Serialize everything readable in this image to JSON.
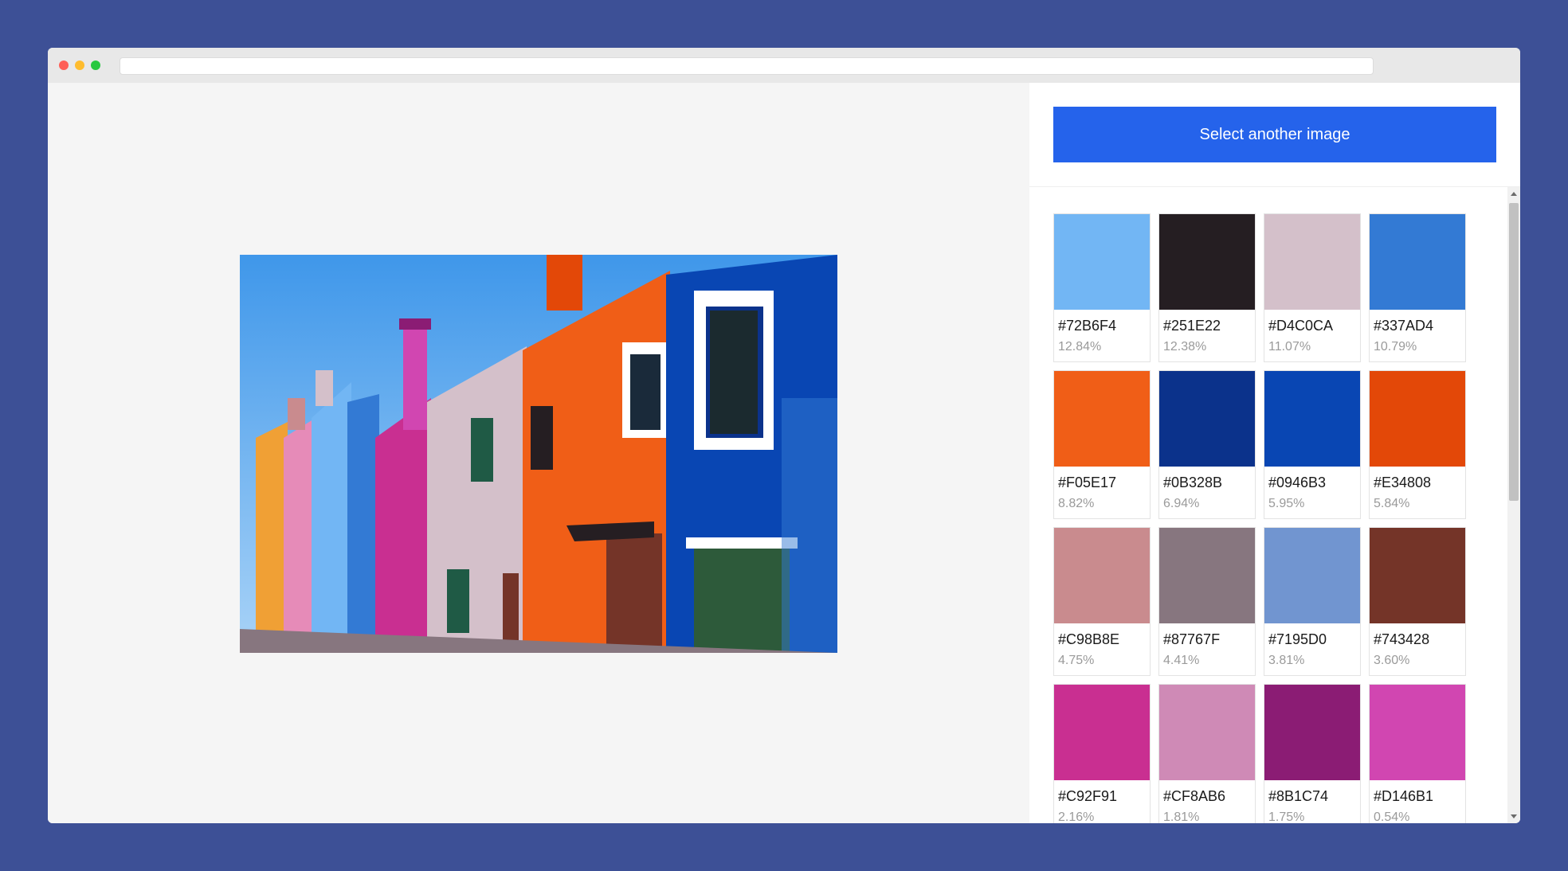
{
  "browser": {
    "url": ""
  },
  "sidebar": {
    "select_button_label": "Select another image"
  },
  "palette": [
    {
      "hex": "#72B6F4",
      "percent": "12.84%"
    },
    {
      "hex": "#251E22",
      "percent": "12.38%"
    },
    {
      "hex": "#D4C0CA",
      "percent": "11.07%"
    },
    {
      "hex": "#337AD4",
      "percent": "10.79%"
    },
    {
      "hex": "#F05E17",
      "percent": "8.82%"
    },
    {
      "hex": "#0B328B",
      "percent": "6.94%"
    },
    {
      "hex": "#0946B3",
      "percent": "5.95%"
    },
    {
      "hex": "#E34808",
      "percent": "5.84%"
    },
    {
      "hex": "#C98B8E",
      "percent": "4.75%"
    },
    {
      "hex": "#87767F",
      "percent": "4.41%"
    },
    {
      "hex": "#7195D0",
      "percent": "3.81%"
    },
    {
      "hex": "#743428",
      "percent": "3.60%"
    },
    {
      "hex": "#C92F91",
      "percent": "2.16%"
    },
    {
      "hex": "#CF8AB6",
      "percent": "1.81%"
    },
    {
      "hex": "#8B1C74",
      "percent": "1.75%"
    },
    {
      "hex": "#D146B1",
      "percent": "0.54%"
    }
  ],
  "colors": {
    "background": "#3d5096",
    "accent": "#2563eb"
  }
}
